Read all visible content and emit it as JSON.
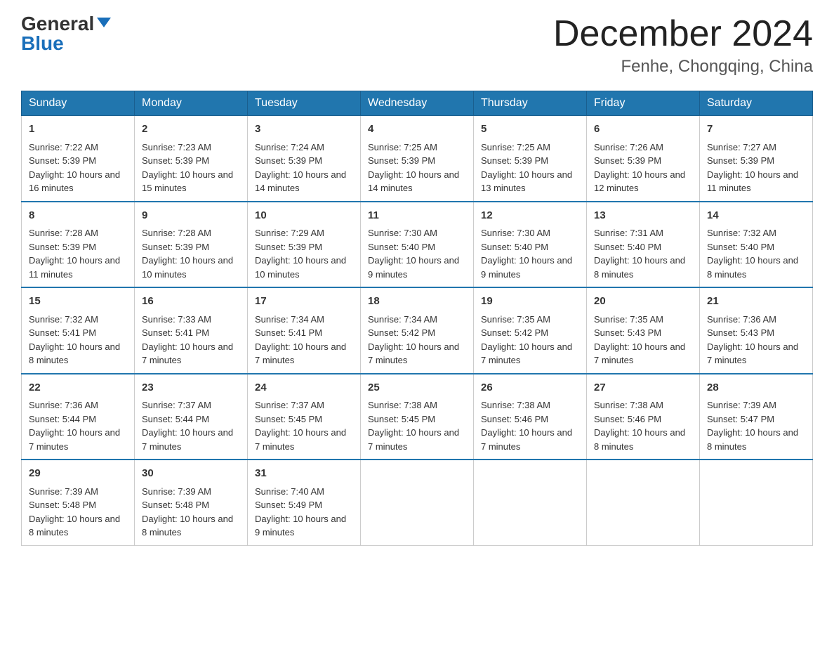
{
  "header": {
    "logo_general": "General",
    "logo_blue": "Blue",
    "month_title": "December 2024",
    "location": "Fenhe, Chongqing, China"
  },
  "weekdays": [
    "Sunday",
    "Monday",
    "Tuesday",
    "Wednesday",
    "Thursday",
    "Friday",
    "Saturday"
  ],
  "weeks": [
    [
      {
        "day": "1",
        "sunrise": "7:22 AM",
        "sunset": "5:39 PM",
        "daylight": "10 hours and 16 minutes."
      },
      {
        "day": "2",
        "sunrise": "7:23 AM",
        "sunset": "5:39 PM",
        "daylight": "10 hours and 15 minutes."
      },
      {
        "day": "3",
        "sunrise": "7:24 AM",
        "sunset": "5:39 PM",
        "daylight": "10 hours and 14 minutes."
      },
      {
        "day": "4",
        "sunrise": "7:25 AM",
        "sunset": "5:39 PM",
        "daylight": "10 hours and 14 minutes."
      },
      {
        "day": "5",
        "sunrise": "7:25 AM",
        "sunset": "5:39 PM",
        "daylight": "10 hours and 13 minutes."
      },
      {
        "day": "6",
        "sunrise": "7:26 AM",
        "sunset": "5:39 PM",
        "daylight": "10 hours and 12 minutes."
      },
      {
        "day": "7",
        "sunrise": "7:27 AM",
        "sunset": "5:39 PM",
        "daylight": "10 hours and 11 minutes."
      }
    ],
    [
      {
        "day": "8",
        "sunrise": "7:28 AM",
        "sunset": "5:39 PM",
        "daylight": "10 hours and 11 minutes."
      },
      {
        "day": "9",
        "sunrise": "7:28 AM",
        "sunset": "5:39 PM",
        "daylight": "10 hours and 10 minutes."
      },
      {
        "day": "10",
        "sunrise": "7:29 AM",
        "sunset": "5:39 PM",
        "daylight": "10 hours and 10 minutes."
      },
      {
        "day": "11",
        "sunrise": "7:30 AM",
        "sunset": "5:40 PM",
        "daylight": "10 hours and 9 minutes."
      },
      {
        "day": "12",
        "sunrise": "7:30 AM",
        "sunset": "5:40 PM",
        "daylight": "10 hours and 9 minutes."
      },
      {
        "day": "13",
        "sunrise": "7:31 AM",
        "sunset": "5:40 PM",
        "daylight": "10 hours and 8 minutes."
      },
      {
        "day": "14",
        "sunrise": "7:32 AM",
        "sunset": "5:40 PM",
        "daylight": "10 hours and 8 minutes."
      }
    ],
    [
      {
        "day": "15",
        "sunrise": "7:32 AM",
        "sunset": "5:41 PM",
        "daylight": "10 hours and 8 minutes."
      },
      {
        "day": "16",
        "sunrise": "7:33 AM",
        "sunset": "5:41 PM",
        "daylight": "10 hours and 7 minutes."
      },
      {
        "day": "17",
        "sunrise": "7:34 AM",
        "sunset": "5:41 PM",
        "daylight": "10 hours and 7 minutes."
      },
      {
        "day": "18",
        "sunrise": "7:34 AM",
        "sunset": "5:42 PM",
        "daylight": "10 hours and 7 minutes."
      },
      {
        "day": "19",
        "sunrise": "7:35 AM",
        "sunset": "5:42 PM",
        "daylight": "10 hours and 7 minutes."
      },
      {
        "day": "20",
        "sunrise": "7:35 AM",
        "sunset": "5:43 PM",
        "daylight": "10 hours and 7 minutes."
      },
      {
        "day": "21",
        "sunrise": "7:36 AM",
        "sunset": "5:43 PM",
        "daylight": "10 hours and 7 minutes."
      }
    ],
    [
      {
        "day": "22",
        "sunrise": "7:36 AM",
        "sunset": "5:44 PM",
        "daylight": "10 hours and 7 minutes."
      },
      {
        "day": "23",
        "sunrise": "7:37 AM",
        "sunset": "5:44 PM",
        "daylight": "10 hours and 7 minutes."
      },
      {
        "day": "24",
        "sunrise": "7:37 AM",
        "sunset": "5:45 PM",
        "daylight": "10 hours and 7 minutes."
      },
      {
        "day": "25",
        "sunrise": "7:38 AM",
        "sunset": "5:45 PM",
        "daylight": "10 hours and 7 minutes."
      },
      {
        "day": "26",
        "sunrise": "7:38 AM",
        "sunset": "5:46 PM",
        "daylight": "10 hours and 7 minutes."
      },
      {
        "day": "27",
        "sunrise": "7:38 AM",
        "sunset": "5:46 PM",
        "daylight": "10 hours and 8 minutes."
      },
      {
        "day": "28",
        "sunrise": "7:39 AM",
        "sunset": "5:47 PM",
        "daylight": "10 hours and 8 minutes."
      }
    ],
    [
      {
        "day": "29",
        "sunrise": "7:39 AM",
        "sunset": "5:48 PM",
        "daylight": "10 hours and 8 minutes."
      },
      {
        "day": "30",
        "sunrise": "7:39 AM",
        "sunset": "5:48 PM",
        "daylight": "10 hours and 8 minutes."
      },
      {
        "day": "31",
        "sunrise": "7:40 AM",
        "sunset": "5:49 PM",
        "daylight": "10 hours and 9 minutes."
      },
      null,
      null,
      null,
      null
    ]
  ]
}
